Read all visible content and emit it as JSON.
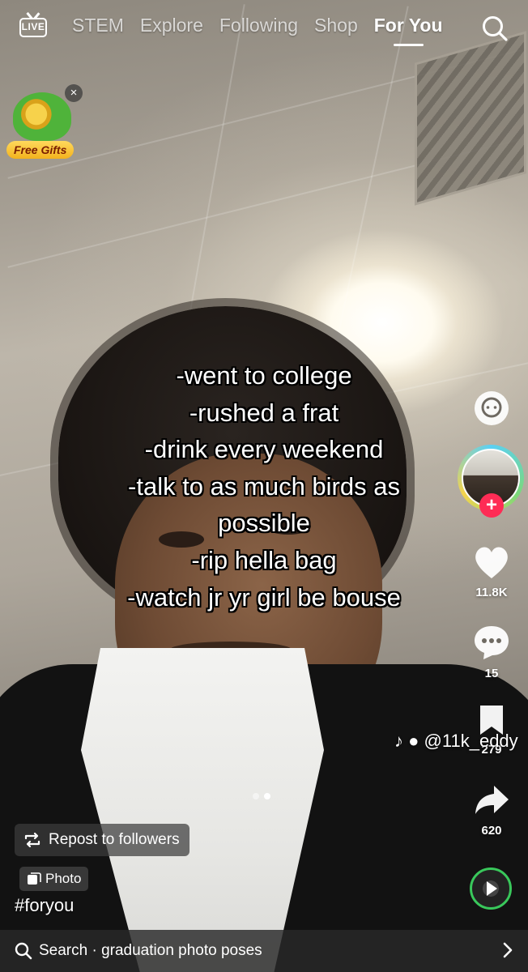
{
  "topnav": {
    "live_label": "LIVE",
    "tabs": [
      {
        "label": "STEM"
      },
      {
        "label": "Explore"
      },
      {
        "label": "Following"
      },
      {
        "label": "Shop"
      },
      {
        "label": "For You"
      }
    ],
    "active_tab": "For You"
  },
  "gifts": {
    "label": "Free Gifts",
    "close_glyph": "×"
  },
  "caption": {
    "lines": [
      "-went to college",
      "-rushed a frat",
      "-drink every weekend",
      "-talk to as much birds as",
      "possible",
      "-rip hella bag",
      "-watch jr yr girl be bouse"
    ]
  },
  "rail": {
    "follow_glyph": "+",
    "likes": "11.8K",
    "comments": "15",
    "saves": "279",
    "shares": "620",
    "icons": [
      "chat-bubble-icon",
      "heart-icon",
      "comment-icon",
      "bookmark-icon",
      "share-icon",
      "music-disc-icon"
    ]
  },
  "creator": {
    "handle": "@11k_eddy"
  },
  "carousel": {
    "current": 2,
    "total": 2
  },
  "bottom": {
    "repost_label": "Repost to followers",
    "type_chip": "Photo",
    "hashtag": "#foryou",
    "search_label": "Search · graduation photo poses"
  },
  "colors": {
    "follow_red": "#fe2c55",
    "music_green": "#39c85b",
    "gift_gold": "#f3b21d"
  }
}
